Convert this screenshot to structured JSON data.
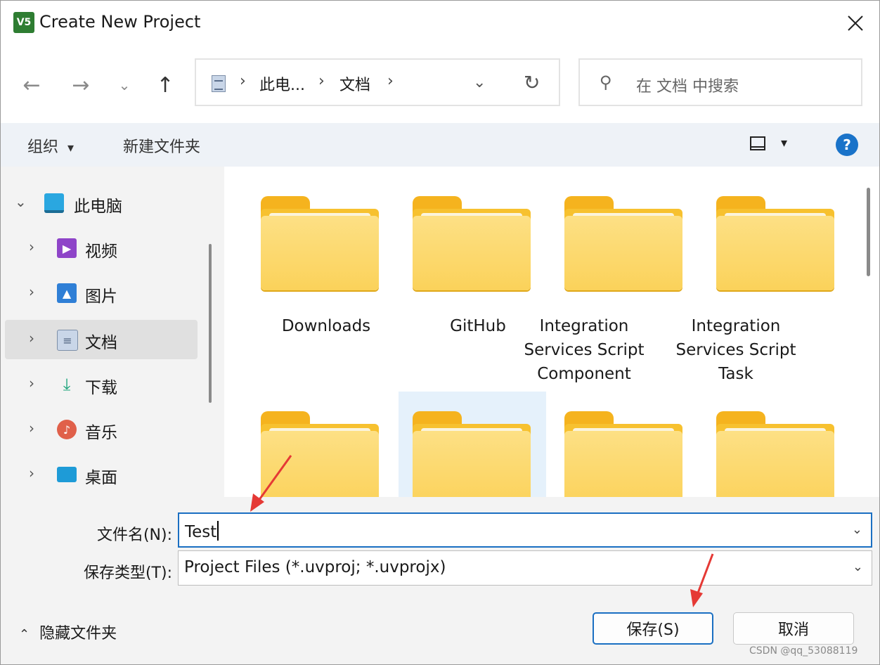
{
  "window": {
    "title": "Create New Project",
    "app_icon_text": "V5"
  },
  "nav": {
    "back_icon": "←",
    "forward_icon": "→",
    "recent_icon": "⌄",
    "up_icon": "↑"
  },
  "address": {
    "sep": "›",
    "crumbs": [
      "此电...",
      "文档"
    ],
    "dropdown_icon": "⌄",
    "refresh_icon": "↻"
  },
  "search": {
    "placeholder": "在 文档 中搜索",
    "icon": "⚲"
  },
  "toolbar": {
    "organize_label": "组织",
    "organize_caret": "▾",
    "new_folder_label": "新建文件夹",
    "view_caret": "▾",
    "help_icon": "?"
  },
  "tree": {
    "root": {
      "label": "此电脑",
      "chevron": "⌄"
    },
    "items": [
      {
        "label": "视频",
        "chevron": "›"
      },
      {
        "label": "图片",
        "chevron": "›"
      },
      {
        "label": "文档",
        "chevron": "›"
      },
      {
        "label": "下载",
        "chevron": "›"
      },
      {
        "label": "音乐",
        "chevron": "›"
      },
      {
        "label": "桌面",
        "chevron": "›"
      }
    ]
  },
  "folders": [
    {
      "label": "Downloads"
    },
    {
      "label": "GitHub"
    },
    {
      "label": "Integration Services Script Component"
    },
    {
      "label": "Integration Services Script Task"
    }
  ],
  "form": {
    "filename_label": "文件名(N):",
    "filename_value": "Test",
    "filetype_label": "保存类型(T):",
    "filetype_value": "Project Files (*.uvproj; *.uvprojx)",
    "dropdown_icon": "⌄"
  },
  "footer": {
    "hide_folders_label": "隐藏文件夹",
    "hide_folders_chevron": "⌃",
    "save_label": "保存(S)",
    "cancel_label": "取消",
    "watermark": "CSDN @qq_53088119"
  },
  "colors": {
    "accent": "#1a6fc2",
    "folder": "#f7c12f",
    "arrow": "#e53935"
  }
}
